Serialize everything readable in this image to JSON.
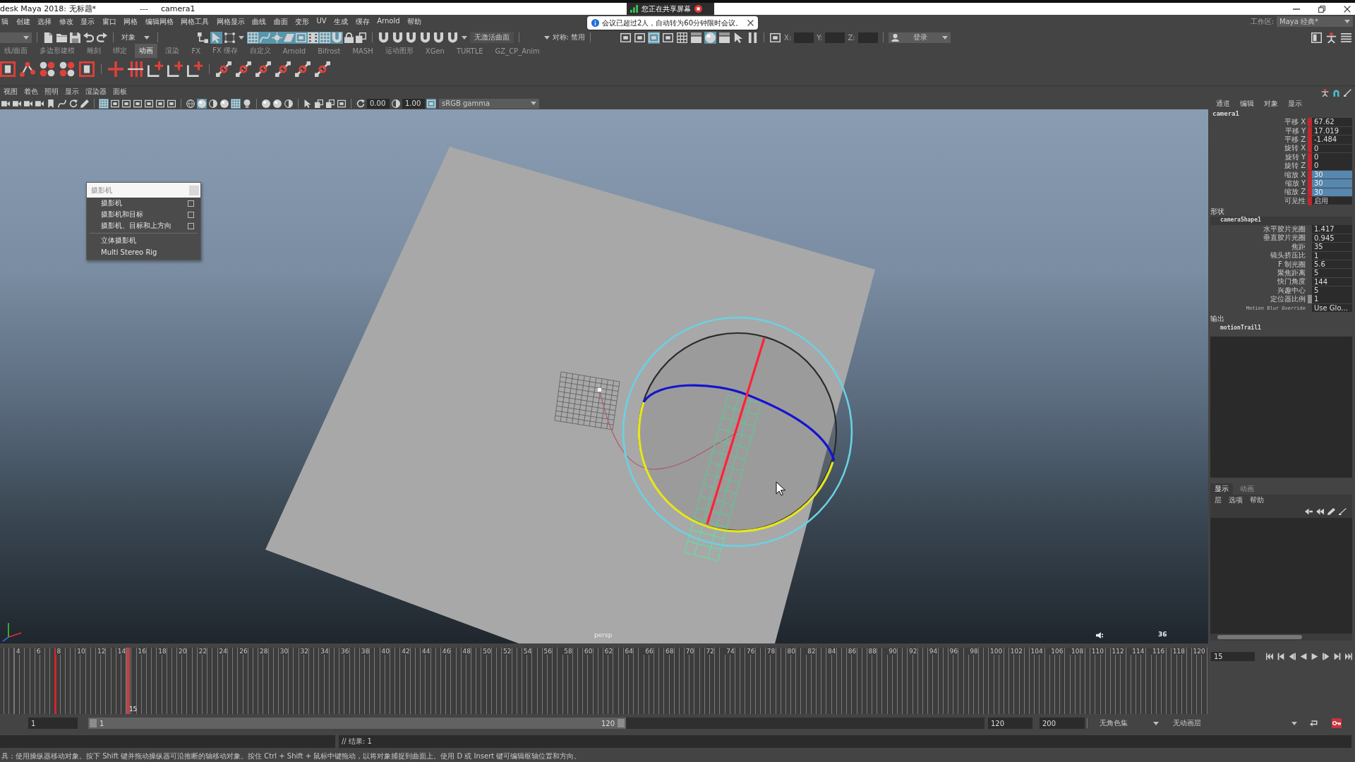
{
  "window": {
    "title": "desk Maya 2018: 无标题*",
    "separator": "---",
    "object": "camera1"
  },
  "screen_share": {
    "label": "您正在共享屏幕"
  },
  "notification": {
    "text": "会议已超过2人，自动转为60分钟限时会议。"
  },
  "menu_bar": [
    "辑",
    "创建",
    "选择",
    "修改",
    "显示",
    "窗口",
    "网格",
    "编辑网格",
    "网格工具",
    "网格显示",
    "曲线",
    "曲面",
    "变形",
    "UV",
    "生成",
    "缓存",
    "Arnold",
    "帮助"
  ],
  "workspace": {
    "label": "工作区:",
    "value": "Maya 经典*"
  },
  "status_line": {
    "file_tools": [
      {
        "kind": "doc",
        "on": false
      },
      {
        "kind": "folder",
        "on": false
      },
      {
        "kind": "disk",
        "on": false
      },
      {
        "kind": "undo",
        "on": false
      },
      {
        "kind": "redo",
        "on": false
      }
    ],
    "selection_mode": "对象",
    "select_tools": [
      {
        "kind": "hierarchy",
        "on": false
      },
      {
        "kind": "cursor",
        "on": true
      },
      {
        "kind": "points",
        "on": false
      }
    ],
    "snap_tools": [
      {
        "kind": "grid",
        "on": true
      },
      {
        "kind": "curve",
        "on": true
      },
      {
        "kind": "crosshair",
        "on": true
      },
      {
        "kind": "plane",
        "on": true
      },
      {
        "kind": "frame",
        "on": true
      },
      {
        "kind": "film",
        "on": true
      },
      {
        "kind": "grid",
        "on": true
      },
      {
        "kind": "magnet",
        "on": true
      },
      {
        "kind": "lock",
        "on": false
      },
      {
        "kind": "layers",
        "on": false
      }
    ],
    "live_tools": [
      {
        "kind": "magnet",
        "on": false
      },
      {
        "kind": "magnet",
        "on": false
      },
      {
        "kind": "magnet",
        "on": false
      },
      {
        "kind": "magnet",
        "on": false
      },
      {
        "kind": "magnet",
        "on": false
      },
      {
        "kind": "magnet",
        "on": false
      }
    ],
    "live_surface": "无激活曲面",
    "symmetry": "对称: 禁用",
    "render_tools": [
      {
        "kind": "frame",
        "on": false
      },
      {
        "kind": "frame",
        "on": false
      },
      {
        "kind": "frame",
        "on": true
      },
      {
        "kind": "frame",
        "on": false
      },
      {
        "kind": "grid",
        "on": false
      },
      {
        "kind": "clapper",
        "on": false
      },
      {
        "kind": "sphere",
        "on": true
      },
      {
        "kind": "clapper",
        "on": false
      },
      {
        "kind": "cursor",
        "on": false
      },
      {
        "kind": "pause",
        "on": false
      }
    ],
    "coordinates": [
      "X:",
      "Y:",
      "Z:"
    ],
    "login": "登录"
  },
  "shelf": {
    "tabs": [
      {
        "label": "线/曲面",
        "selected": false
      },
      {
        "label": "多边形建模",
        "selected": false
      },
      {
        "label": "雕刻",
        "selected": false
      },
      {
        "label": "绑定",
        "selected": false
      },
      {
        "label": "动画",
        "selected": true
      },
      {
        "label": "渲染",
        "selected": false
      },
      {
        "label": "FX",
        "selected": false
      },
      {
        "label": "FX 缓存",
        "selected": false
      },
      {
        "label": "自定义",
        "selected": false
      },
      {
        "label": "Arnold",
        "selected": false
      },
      {
        "label": "Bifrost",
        "selected": false
      },
      {
        "label": "MASH",
        "selected": false
      },
      {
        "label": "运动图形",
        "selected": false
      },
      {
        "label": "XGen",
        "selected": false
      },
      {
        "label": "TURTLE",
        "selected": false
      },
      {
        "label": "GZ_CP_Anim",
        "selected": false
      }
    ]
  },
  "viewport": {
    "menu": [
      "视图",
      "着色",
      "照明",
      "显示",
      "渲染器",
      "面板"
    ],
    "toolbar": {
      "groups": [
        [
          {
            "kind": "camera",
            "on": false
          },
          {
            "kind": "camera",
            "on": false
          },
          {
            "kind": "camera",
            "on": false
          },
          {
            "kind": "camera",
            "on": false
          },
          {
            "kind": "bookmark",
            "on": false
          },
          {
            "kind": "curve",
            "on": false
          },
          {
            "kind": "rotate",
            "on": false
          },
          {
            "kind": "pencil",
            "on": false
          }
        ],
        [
          {
            "kind": "grid",
            "on": true
          },
          {
            "kind": "frame",
            "on": false
          },
          {
            "kind": "frame",
            "on": false
          },
          {
            "kind": "frame",
            "on": false
          },
          {
            "kind": "frame",
            "on": false
          },
          {
            "kind": "frame",
            "on": false
          },
          {
            "kind": "frame",
            "on": false
          }
        ],
        [
          {
            "kind": "wiresphere",
            "on": false
          },
          {
            "kind": "sphere",
            "on": true
          },
          {
            "kind": "halfcircle",
            "on": false
          },
          {
            "kind": "sphere",
            "on": false
          },
          {
            "kind": "grid",
            "on": true
          },
          {
            "kind": "bulb",
            "on": false
          }
        ],
        [
          {
            "kind": "sphere",
            "on": false
          },
          {
            "kind": "sphere",
            "on": false
          },
          {
            "kind": "halfcircle",
            "on": false
          }
        ],
        [
          {
            "kind": "cursor",
            "on": false
          },
          {
            "kind": "layers",
            "on": false
          },
          {
            "kind": "layers",
            "on": false
          },
          {
            "kind": "frame",
            "on": false
          }
        ]
      ],
      "exposure": "0.00",
      "gamma": "1.00",
      "color_management": {
        "on": true
      },
      "color_space": "sRGB gamma"
    },
    "camera": "persp",
    "hud_value": "36",
    "create_menu": {
      "title": "摄影机",
      "items": [
        {
          "label": "摄影机",
          "option_box": true,
          "separator_before": false
        },
        {
          "label": "摄影机和目标",
          "option_box": true,
          "separator_before": false
        },
        {
          "label": "摄影机、目标和上方向",
          "option_box": true,
          "separator_before": false
        },
        {
          "label": "立体摄影机",
          "option_box": false,
          "separator_before": true
        },
        {
          "label": "Multi Stereo Rig",
          "option_box": false,
          "separator_before": false
        }
      ]
    }
  },
  "channel_box": {
    "menu": [
      "通道",
      "编辑",
      "对象",
      "显示"
    ],
    "object": "camera1",
    "channels": [
      {
        "label": "平移 X",
        "value": "67.62",
        "keyed": true,
        "selected": false
      },
      {
        "label": "平移 Y",
        "value": "17.019",
        "keyed": true,
        "selected": false
      },
      {
        "label": "平移 Z",
        "value": "-1.484",
        "keyed": true,
        "selected": false
      },
      {
        "label": "旋转 X",
        "value": "0",
        "keyed": true,
        "selected": false
      },
      {
        "label": "旋转 Y",
        "value": "0",
        "keyed": true,
        "selected": false
      },
      {
        "label": "旋转 Z",
        "value": "0",
        "keyed": true,
        "selected": false
      },
      {
        "label": "缩放 X",
        "value": "30",
        "keyed": true,
        "selected": true
      },
      {
        "label": "缩放 Y",
        "value": "30",
        "keyed": true,
        "selected": true
      },
      {
        "label": "缩放 Z",
        "value": "30",
        "keyed": true,
        "selected": true
      },
      {
        "label": "可见性",
        "value": "启用",
        "keyed": true,
        "selected": false
      }
    ],
    "shape_header": "形状",
    "shape": "cameraShape1",
    "shape_channels": [
      {
        "label": "水平胶片光圈",
        "value": "1.417",
        "nonkeyable": false
      },
      {
        "label": "垂直胶片光圈",
        "value": "0.945",
        "nonkeyable": false
      },
      {
        "label": "焦距",
        "value": "35",
        "nonkeyable": false
      },
      {
        "label": "镜头挤压比",
        "value": "1",
        "nonkeyable": false
      },
      {
        "label": "F 制光圈",
        "value": "5.6",
        "nonkeyable": false
      },
      {
        "label": "聚焦距离",
        "value": "5",
        "nonkeyable": false
      },
      {
        "label": "快门角度",
        "value": "144",
        "nonkeyable": false
      },
      {
        "label": "兴趣中心",
        "value": "5",
        "nonkeyable": false
      },
      {
        "label": "定位器比例",
        "value": "1",
        "nonkeyable": true
      }
    ],
    "extra_channel": {
      "label": "Motion Blur Override",
      "value": "Use Glo..."
    },
    "outputs_header": "输出",
    "output": "motionTrail1"
  },
  "layer_editor": {
    "tabs": [
      {
        "label": "显示",
        "selected": true
      },
      {
        "label": "动画",
        "selected": false
      }
    ],
    "menu": [
      "层",
      "选项",
      "帮助"
    ]
  },
  "timeline": {
    "ticks": [
      {
        "label": "4",
        "key": false
      },
      {
        "label": "6",
        "key": false
      },
      {
        "label": "8",
        "key": true
      },
      {
        "label": "10",
        "key": false
      },
      {
        "label": "12",
        "key": false
      },
      {
        "label": "14",
        "key": false
      },
      {
        "label": "16",
        "key": false
      },
      {
        "label": "18",
        "key": false
      },
      {
        "label": "20",
        "key": false
      },
      {
        "label": "22",
        "key": false
      },
      {
        "label": "24",
        "key": false
      },
      {
        "label": "26",
        "key": false
      },
      {
        "label": "28",
        "key": false
      },
      {
        "label": "30",
        "key": false
      },
      {
        "label": "32",
        "key": false
      },
      {
        "label": "34",
        "key": false
      },
      {
        "label": "36",
        "key": false
      },
      {
        "label": "38",
        "key": false
      },
      {
        "label": "40",
        "key": false
      },
      {
        "label": "42",
        "key": false
      },
      {
        "label": "44",
        "key": false
      },
      {
        "label": "46",
        "key": false
      },
      {
        "label": "48",
        "key": false
      },
      {
        "label": "50",
        "key": false
      },
      {
        "label": "52",
        "key": false
      },
      {
        "label": "54",
        "key": false
      },
      {
        "label": "56",
        "key": false
      },
      {
        "label": "58",
        "key": false
      },
      {
        "label": "60",
        "key": false
      },
      {
        "label": "62",
        "key": false
      },
      {
        "label": "64",
        "key": false
      },
      {
        "label": "66",
        "key": false
      },
      {
        "label": "68",
        "key": false
      },
      {
        "label": "70",
        "key": false
      },
      {
        "label": "72",
        "key": false
      },
      {
        "label": "74",
        "key": false
      },
      {
        "label": "76",
        "key": false
      },
      {
        "label": "78",
        "key": false
      },
      {
        "label": "80",
        "key": false
      },
      {
        "label": "82",
        "key": false
      },
      {
        "label": "84",
        "key": false
      },
      {
        "label": "86",
        "key": false
      },
      {
        "label": "88",
        "key": false
      },
      {
        "label": "90",
        "key": false
      },
      {
        "label": "92",
        "key": false
      },
      {
        "label": "94",
        "key": false
      },
      {
        "label": "96",
        "key": false
      },
      {
        "label": "98",
        "key": false
      },
      {
        "label": "100",
        "key": false
      },
      {
        "label": "102",
        "key": false
      },
      {
        "label": "104",
        "key": false
      },
      {
        "label": "106",
        "key": false
      },
      {
        "label": "108",
        "key": false
      },
      {
        "label": "110",
        "key": false
      },
      {
        "label": "112",
        "key": false
      },
      {
        "label": "114",
        "key": false
      },
      {
        "label": "116",
        "key": false
      },
      {
        "label": "118",
        "key": false
      },
      {
        "label": "120",
        "key": false
      }
    ],
    "playhead": {
      "label": "15",
      "level": 0.1045
    },
    "current_time": "15"
  },
  "range_slider": {
    "animation_start": "1",
    "range_start": "1",
    "range_end": "120",
    "level": 0.6,
    "playback_end": "120",
    "animation_end": "200",
    "character_set": "无角色集",
    "anim_layer": "无动画层",
    "auto_key": {
      "on": true
    }
  },
  "command_line": {
    "result": "// 结果: 1"
  },
  "help_line": "具：使用操纵器移动对象。按下 Shift 键并拖动操纵器可沿推断的轴移动对象。按住 Ctrl + Shift + 鼠标中键拖动，以将对象捕捉到曲面上。使用 D 或 Insert 键可编辑枢轴位置和方向。"
}
